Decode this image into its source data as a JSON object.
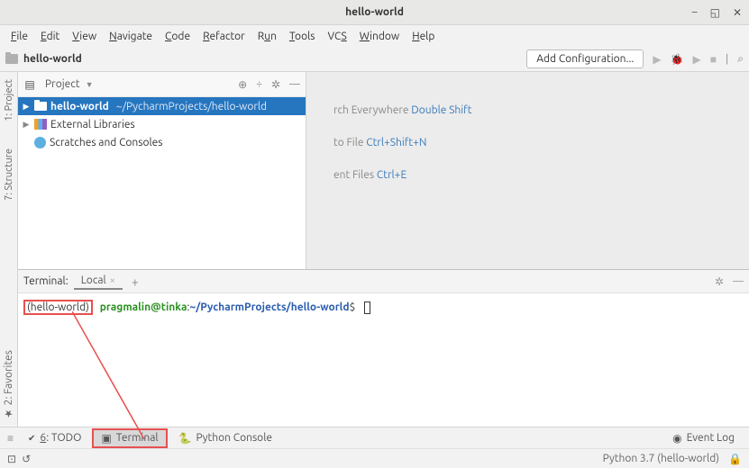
{
  "window": {
    "title": "hello-world"
  },
  "menu": [
    "File",
    "Edit",
    "View",
    "Navigate",
    "Code",
    "Refactor",
    "Run",
    "Tools",
    "VCS",
    "Window",
    "Help"
  ],
  "breadcrumb": {
    "project": "hello-world"
  },
  "toolbar": {
    "add_configuration": "Add Configuration..."
  },
  "vertical_tabs": {
    "project": "1: Project",
    "structure": "7: Structure",
    "favorites": "2: Favorites"
  },
  "project_panel": {
    "label": "Project",
    "tree": {
      "root": {
        "name": "hello-world",
        "path": "~/PycharmProjects/hello-world"
      },
      "external_libs": "External Libraries",
      "scratches": "Scratches and Consoles"
    }
  },
  "editor_hints": [
    {
      "text_suffix": "rch Everywhere ",
      "kbd": "Double Shift"
    },
    {
      "text_suffix": "to File ",
      "kbd": "Ctrl+Shift+N"
    },
    {
      "text_suffix": "ent Files ",
      "kbd": "Ctrl+E"
    }
  ],
  "terminal": {
    "title": "Terminal:",
    "tab": "Local",
    "venv": "(hello-world)",
    "user_host": "pragmalin@tinka",
    "path": "~/PycharmProjects/hello-world",
    "prompt_char": "$"
  },
  "bottom_tools": {
    "todo": "6: TODO",
    "terminal": "Terminal",
    "python_console": "Python Console",
    "event_log": "Event Log"
  },
  "status": {
    "interpreter": "Python 3.7 (hello-world)"
  }
}
